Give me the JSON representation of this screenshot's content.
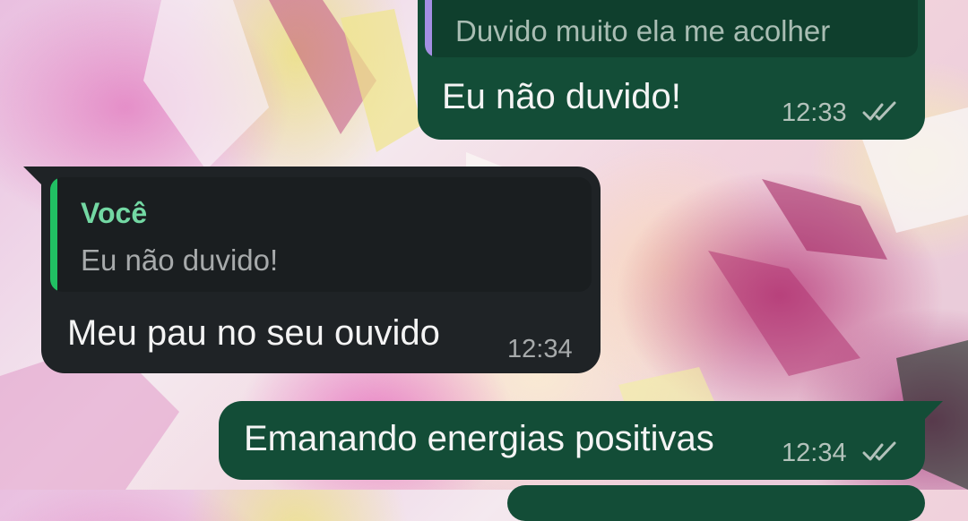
{
  "colors": {
    "outgoing_bubble": "#134d37",
    "incoming_bubble": "#1f2326",
    "quote_author": "#73d8a3",
    "quote_bar_incoming": "#21c063",
    "quote_bar_outgoing": "#a58fe3",
    "read_ticks": "#b3c2bb"
  },
  "messages": [
    {
      "direction": "outgoing",
      "quote_text": "Duvido muito ela me acolher",
      "text": "Eu não duvido!",
      "time": "12:33",
      "status_icon": "double-check-icon"
    },
    {
      "direction": "incoming",
      "quote_author": "Você",
      "quote_text": "Eu não duvido!",
      "text": "Meu pau no seu ouvido",
      "time": "12:34"
    },
    {
      "direction": "outgoing",
      "text": "Emanando energias positivas",
      "time": "12:34",
      "status_icon": "double-check-icon"
    }
  ]
}
